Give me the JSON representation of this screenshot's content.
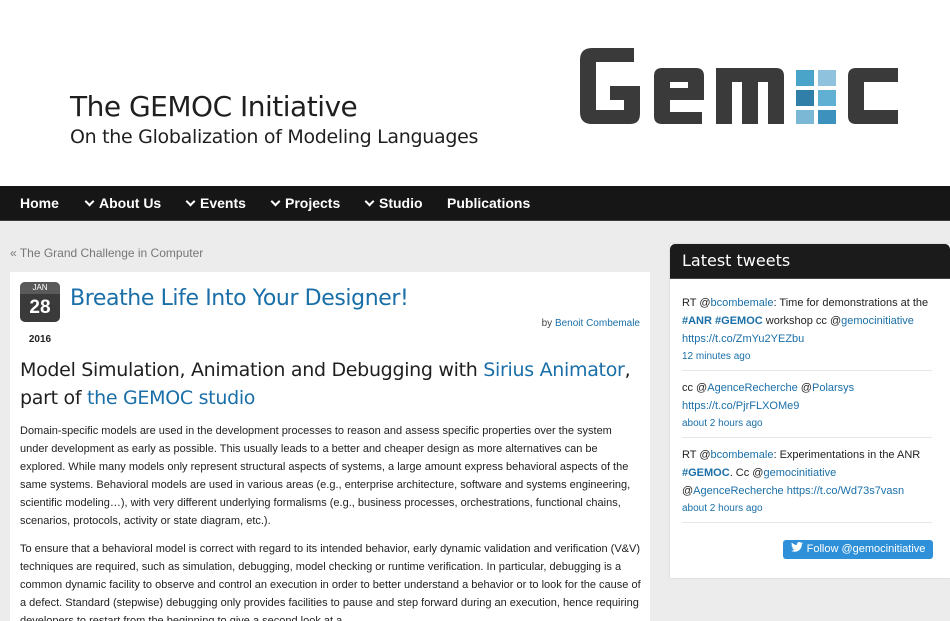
{
  "header": {
    "title": "The GEMOC Initiative",
    "subtitle": "On the Globalization of Modeling Languages",
    "logo_text": "GEMOC"
  },
  "nav": {
    "items": [
      {
        "label": "Home",
        "dropdown": false
      },
      {
        "label": "About Us",
        "dropdown": true
      },
      {
        "label": "Events",
        "dropdown": true
      },
      {
        "label": "Projects",
        "dropdown": true
      },
      {
        "label": "Studio",
        "dropdown": true
      },
      {
        "label": "Publications",
        "dropdown": false
      }
    ]
  },
  "breadcrumb": {
    "prev_arrow": "«",
    "prev_label": "The Grand Challenge in Computer"
  },
  "post": {
    "date": {
      "month": "JAN",
      "day": "28",
      "year": "2016"
    },
    "title": "Breathe Life Into Your Designer!",
    "by": "by",
    "author": "Benoit Combemale",
    "heading_pre": "Model Simulation, Animation and Debugging with ",
    "heading_link1": "Sirius Animator",
    "heading_mid": ", part of ",
    "heading_link2": "the GEMOC studio",
    "para1": "Domain-specific models are used in the development processes to reason and assess specific properties over the system under development as early as possible. This usually leads to a better and cheaper design as more alternatives can be explored. While many models only represent structural aspects of systems, a large amount express behavioral aspects of the same systems. Behavioral models are used in various areas (e.g., enterprise architecture, software and systems engineering, scientific modeling…), with very different underlying formalisms (e.g., business processes, orchestrations, functional chains, scenarios, protocols, activity or state diagram, etc.).",
    "para2": "To ensure that a behavioral model is correct with regard to its intended behavior, early dynamic validation and verification (V&V) techniques are required, such as simulation, debugging, model checking or runtime verification. In particular, debugging is a common dynamic facility to observe and control an execution in order to better understand a behavior or to look for the cause of a defect. Standard (stepwise) debugging only provides facilities to pause and step forward during an execution, hence requiring developers to restart from the beginning to give a second look at a"
  },
  "sidebar": {
    "title": "Latest tweets",
    "tweets": [
      {
        "rt": "RT @",
        "user": "bcombemale",
        "text1": ": Time for demonstrations at the ",
        "tag1": "#ANR",
        "sp1": " ",
        "tag2": "#GEMOC",
        "text2": " workshop cc @",
        "user2": "gemocinitiative",
        "sp2": " ",
        "link": "https://t.co/ZmYu2YEZbu",
        "time": "12 minutes ago"
      },
      {
        "pre": "cc @",
        "user": "AgenceRecherche",
        "mid": " @",
        "user2": "Polarsys",
        "link": "https://t.co/PjrFLXOMe9",
        "time": "about 2 hours ago"
      },
      {
        "rt": "RT @",
        "user": "bcombemale",
        "text1": ": Experimentations in the ANR ",
        "tag1": "#GEMOC",
        "text2": ". Cc @",
        "user2": "gemocinitiative",
        "text3": " @",
        "user3": "AgenceRecherche",
        "sp": " ",
        "link": "https://t.co/Wd73s7vasn",
        "time": "about 2 hours ago"
      }
    ],
    "follow_label": "Follow @gemocinitiative"
  },
  "colors": {
    "link": "#1a6fa8",
    "nav_bg": "#161616",
    "logo_dark": "#3a3a3a",
    "logo_accent": "#4aa3c9",
    "follow_btn": "#2e90d8"
  }
}
